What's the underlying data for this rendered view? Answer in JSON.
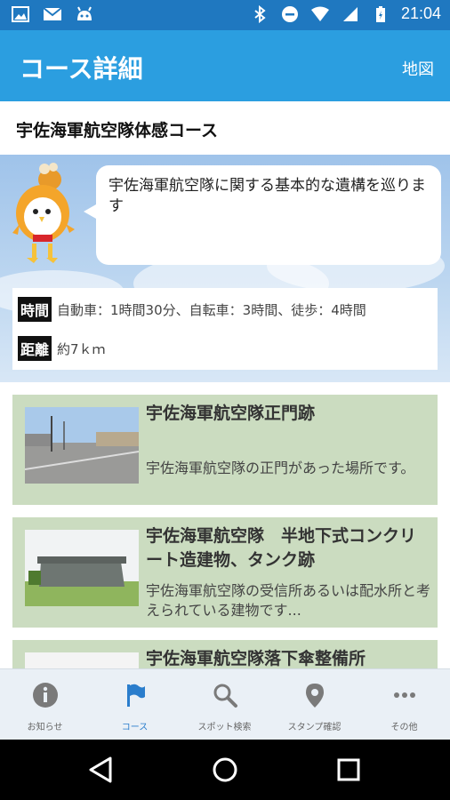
{
  "status_bar": {
    "time": "21:04",
    "icons": [
      "image-icon",
      "gmail-icon",
      "android-icon",
      "bluetooth-icon",
      "dnd-icon",
      "wifi-icon",
      "signal-icon",
      "battery-icon"
    ]
  },
  "app_bar": {
    "title": "コース詳細",
    "map_label": "地図"
  },
  "course": {
    "name": "宇佐海軍航空隊体感コース",
    "description": "宇佐海軍航空隊に関する基本的な遺構を巡ります",
    "time_label": "時間",
    "time_value": "自動車：1時間30分、自転車：3時間、徒歩：4時間",
    "distance_label": "距離",
    "distance_value": "約7ｋｍ"
  },
  "spots": [
    {
      "title": "宇佐海軍航空隊正門跡",
      "description": "宇佐海軍航空隊の正門があった場所です。"
    },
    {
      "title": "宇佐海軍航空隊　半地下式コンクリート造建物、タンク跡",
      "description": "宇佐海軍航空隊の受信所あるいは配水所と考えられている建物です..."
    },
    {
      "title": "宇佐海軍航空隊落下傘整備所",
      "description": ""
    }
  ],
  "tabs": [
    {
      "label": "お知らせ",
      "icon": "info-icon"
    },
    {
      "label": "コース",
      "icon": "flag-icon"
    },
    {
      "label": "スポット検索",
      "icon": "search-icon"
    },
    {
      "label": "スタンプ確認",
      "icon": "pin-icon"
    },
    {
      "label": "その他",
      "icon": "more-icon"
    }
  ],
  "colors": {
    "status_bar": "#1f78c0",
    "app_bar": "#2b9ee0",
    "card_bg": "#cbdcc0",
    "tab_active": "#2a7dcc",
    "tab_inactive": "#666666"
  }
}
